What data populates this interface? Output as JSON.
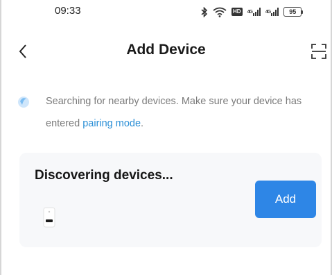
{
  "status_bar": {
    "time": "09:33",
    "bluetooth_icon": "bluetooth-icon",
    "wifi_icon": "wifi-icon",
    "hd_badge": "HD",
    "signal_1_icon": "signal-4g-icon",
    "signal_2_icon": "signal-4g-icon",
    "signal_label": "4G",
    "battery": "95"
  },
  "header": {
    "title": "Add Device",
    "back_icon": "chevron-left-icon",
    "scan_icon": "scan-icon"
  },
  "hint": {
    "icon": "bluetooth-search-icon",
    "text_prefix": "Searching for nearby devices. Make sure your device has entered ",
    "link": "pairing mode",
    "text_suffix": "."
  },
  "discovery": {
    "title": "Discovering devices...",
    "device_icon": "smart-plug-icon",
    "add_label": "Add"
  },
  "colors": {
    "accent": "#2e86e6",
    "link": "#2b8fd6",
    "card_bg": "#f7f8fa"
  }
}
